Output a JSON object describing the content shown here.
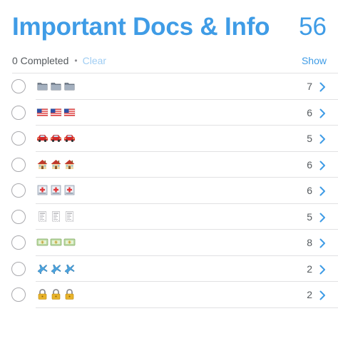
{
  "header": {
    "title": "Important Docs & Info",
    "count": "56"
  },
  "subbar": {
    "completed": "0 Completed",
    "separator": "•",
    "clear": "Clear",
    "show": "Show"
  },
  "rows": [
    {
      "icon": "folder-icon",
      "count": "7"
    },
    {
      "icon": "us-flag-icon",
      "count": "6"
    },
    {
      "icon": "car-icon",
      "count": "5"
    },
    {
      "icon": "house-icon",
      "count": "6"
    },
    {
      "icon": "hospital-icon",
      "count": "6"
    },
    {
      "icon": "receipt-icon",
      "count": "5"
    },
    {
      "icon": "money-icon",
      "count": "8"
    },
    {
      "icon": "airplane-icon",
      "count": "2"
    },
    {
      "icon": "lock-icon",
      "count": "2"
    }
  ]
}
